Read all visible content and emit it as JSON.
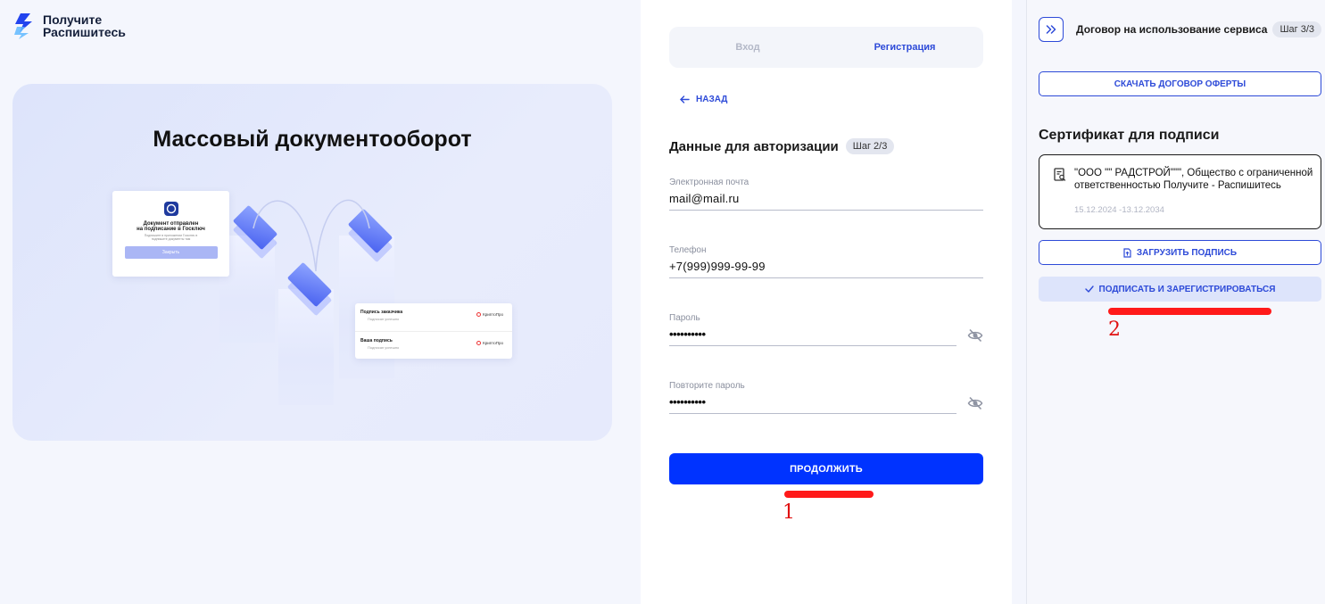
{
  "brand": {
    "line1": "Получите",
    "line2": "Распишитесь"
  },
  "hero": {
    "title": "Массовый документооборот",
    "notice_card": {
      "title_line1": "Документ отправлен",
      "title_line2": "на подписание в Госключ",
      "text_line1": "Подпишите в приложении Госключ в",
      "text_line2": "подпишите документы там",
      "button": "Закрыть"
    },
    "sign_card": {
      "row1_title": "Подпись заказчика",
      "row1_sub": "Подписан успешно",
      "row2_title": "Ваша подпись",
      "row2_sub": "Подписан успешно",
      "provider": "КриптоПро"
    }
  },
  "tabs": [
    {
      "label": "Вход",
      "active": false
    },
    {
      "label": "Регистрация",
      "active": true
    }
  ],
  "back_label": "НАЗАД",
  "section": {
    "title": "Данные для авторизации",
    "step": "Шаг 2/3"
  },
  "fields": [
    {
      "label": "Электронная почта",
      "value": "mail@mail.ru",
      "type": "text"
    },
    {
      "label": "Телефон",
      "value": "+7(999)999-99-99",
      "type": "text"
    },
    {
      "label": "Пароль",
      "value": "••••••••••",
      "type": "password"
    },
    {
      "label": "Повторите пароль",
      "value": "••••••••••",
      "type": "password"
    }
  ],
  "continue_label": "ПРОДОЛЖИТЬ",
  "annotations": {
    "mark1": "1",
    "mark2": "2"
  },
  "right": {
    "title": "Договор на использование сервиса",
    "step": "Шаг 3/3",
    "download_label": "СКАЧАТЬ ДОГОВОР ОФЕРТЫ",
    "cert_title": "Сертификат для подписи",
    "cert": {
      "name": "\"ООО \"\"  РАДСТРОЙ\"\"\", Общество с ограниченной ответственностью Получите - Распишитесь",
      "dates": "15.12.2024 -13.12.2034"
    },
    "upload_label": "ЗАГРУЗИТЬ ПОДПИСЬ",
    "sign_label": "ПОДПИСАТЬ И ЗАРЕГИСТРИРОВАТЬСЯ"
  },
  "colors": {
    "accent": "#0033ff",
    "link": "#2d4ad8",
    "annotation": "#ff1a1a"
  }
}
